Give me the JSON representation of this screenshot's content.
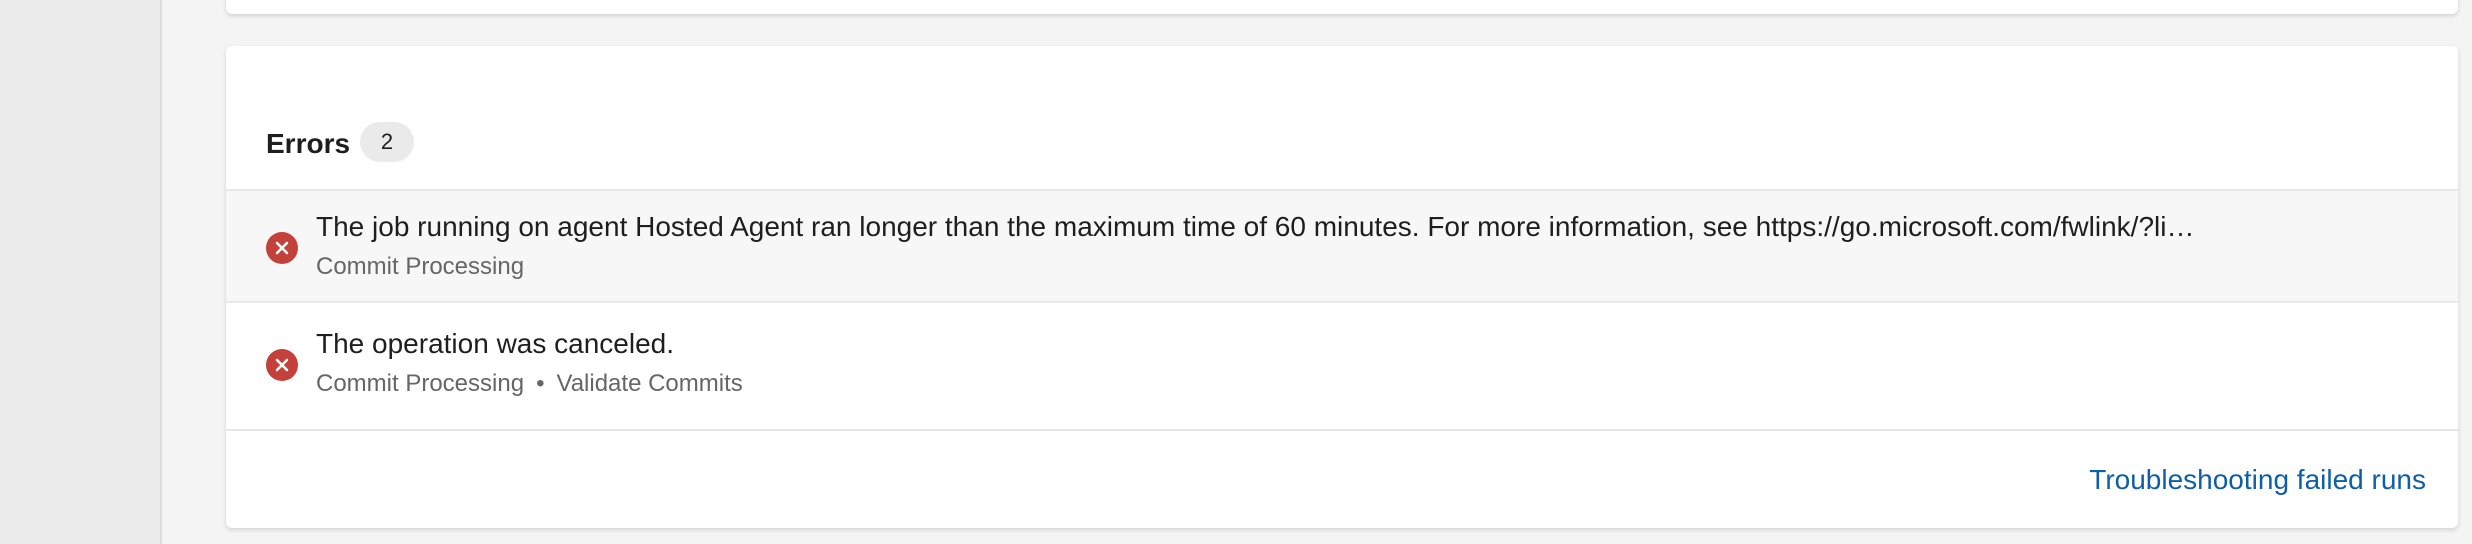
{
  "errors_card": {
    "tab_label": "Errors",
    "tab_count": "2"
  },
  "errors": [
    {
      "message": "The job running on agent Hosted Agent ran longer than the maximum time of 60 minutes. For more information, see https://go.microsoft.com/fwlink/?li…",
      "stage": "Commit Processing"
    },
    {
      "message": "The operation was canceled.",
      "stage": "Commit Processing",
      "job_separator": "•",
      "job": "Validate Commits"
    }
  ],
  "footer": {
    "link_text": "Troubleshooting failed runs"
  },
  "colors": {
    "accent": "#0f6cbd",
    "error": "#c4403a",
    "link": "#0f5ea8"
  },
  "icons": {
    "error_status": "error-circle-icon"
  }
}
